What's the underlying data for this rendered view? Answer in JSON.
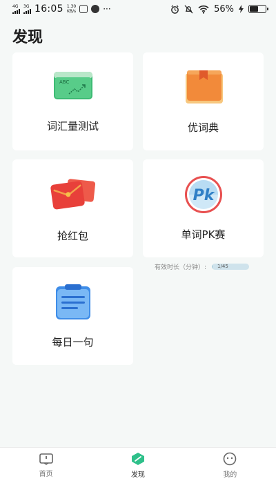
{
  "status_bar": {
    "network_1": "4G",
    "network_2": "3G",
    "time": "16:05",
    "speed_value": "1.30",
    "speed_unit": "KB/s",
    "more": "···",
    "battery": "56%"
  },
  "page": {
    "title": "发现"
  },
  "cards": [
    {
      "label": "词汇量测试",
      "icon": "vocabulary-test-icon"
    },
    {
      "label": "优词典",
      "icon": "dictionary-icon"
    },
    {
      "label": "抢红包",
      "icon": "red-envelope-icon"
    },
    {
      "label": "单词PK赛",
      "icon": "pk-icon",
      "icon_text": "Pk"
    },
    {
      "label": "每日一句",
      "icon": "daily-sentence-icon"
    }
  ],
  "abc_text": "ABC",
  "study_timer": {
    "label": "有效时长（分钟）:",
    "value": "1/45",
    "progress": 0.022
  },
  "tabs": [
    {
      "label": "首页",
      "icon": "home-icon"
    },
    {
      "label": "发现",
      "icon": "discover-icon",
      "active": true
    },
    {
      "label": "我的",
      "icon": "profile-icon"
    }
  ],
  "colors": {
    "accent_green": "#2ec08a",
    "red_envelope": "#e8403a",
    "pk_blue": "#3a86c8"
  }
}
